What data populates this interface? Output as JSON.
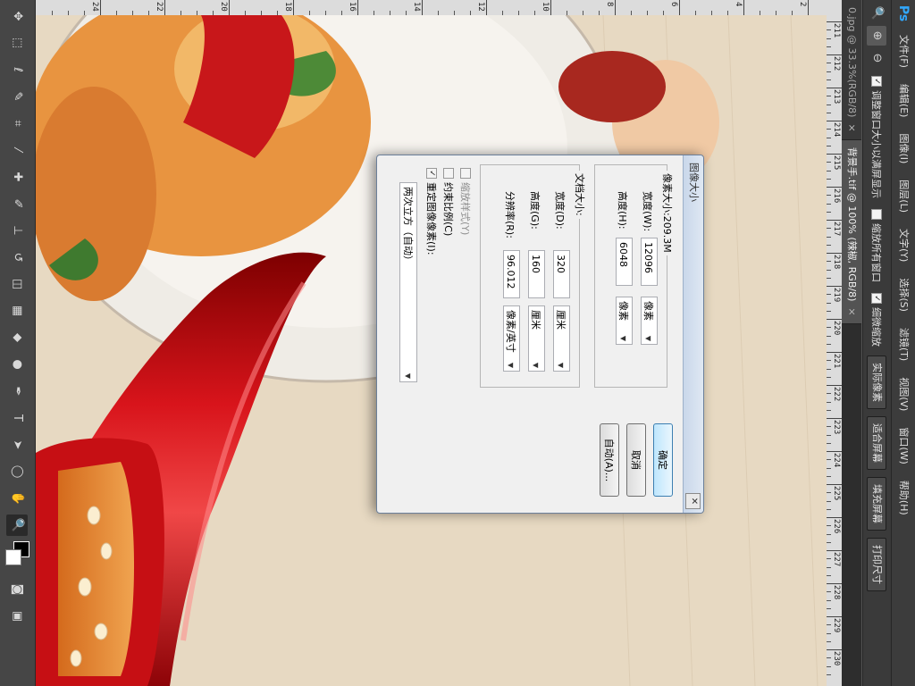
{
  "app": {
    "logo": "Ps"
  },
  "menu": [
    "文件(F)",
    "编辑(E)",
    "图像(I)",
    "图层(L)",
    "文字(Y)",
    "选择(S)",
    "滤镜(T)",
    "视图(V)",
    "窗口(W)",
    "帮助(H)"
  ],
  "options": {
    "resize_windows": {
      "label": "调整窗口大小以满屏显示",
      "checked": true
    },
    "zoom_all": {
      "label": "缩放所有窗口",
      "checked": false
    },
    "scrubby_zoom": {
      "label": "细微缩放",
      "checked": true
    },
    "buttons": [
      "实际像素",
      "适合屏幕",
      "填充屏幕",
      "打印尺寸"
    ]
  },
  "tabs": [
    {
      "label": "0.jpg @ 33.3%(RGB/8)",
      "active": false
    },
    {
      "label": "背景手.tif @ 100% (辣椒, RGB/8)",
      "active": true
    }
  ],
  "ruler_numbers": [
    "211",
    "212",
    "213",
    "214",
    "215",
    "216",
    "217",
    "218",
    "219",
    "220",
    "221",
    "222",
    "223",
    "224",
    "225",
    "226",
    "227",
    "228",
    "229",
    "230"
  ],
  "vruler_numbers": [
    "2",
    "4",
    "6",
    "8",
    "10",
    "12",
    "14",
    "16",
    "18",
    "20",
    "22",
    "24"
  ],
  "dialog": {
    "title": "图像大小",
    "pixel_dimensions": {
      "legend": "像素大小:209.3M",
      "width_label": "宽度(W):",
      "width_value": "12096",
      "width_unit": "像素",
      "height_label": "高度(H):",
      "height_value": "6048",
      "height_unit": "像素"
    },
    "document_size": {
      "legend": "文档大小:",
      "width_label": "宽度(D):",
      "width_value": "320",
      "width_unit": "厘米",
      "height_label": "高度(G):",
      "height_value": "160",
      "height_unit": "厘米",
      "resolution_label": "分辨率(R):",
      "resolution_value": "96.012",
      "resolution_unit": "像素/英寸"
    },
    "scale_styles": {
      "label": "缩放样式(Y)",
      "checked": false
    },
    "constrain": {
      "label": "约束比例(C)",
      "checked": false
    },
    "resample": {
      "label": "重定图像像素(I):",
      "checked": true
    },
    "resample_method": "两次立方（自动）",
    "ok": "确定",
    "cancel": "取消",
    "auto": "自动(A)..."
  },
  "colors": {
    "accent": "#31a8ff",
    "foreground": "#000000",
    "background": "#ffffff"
  }
}
